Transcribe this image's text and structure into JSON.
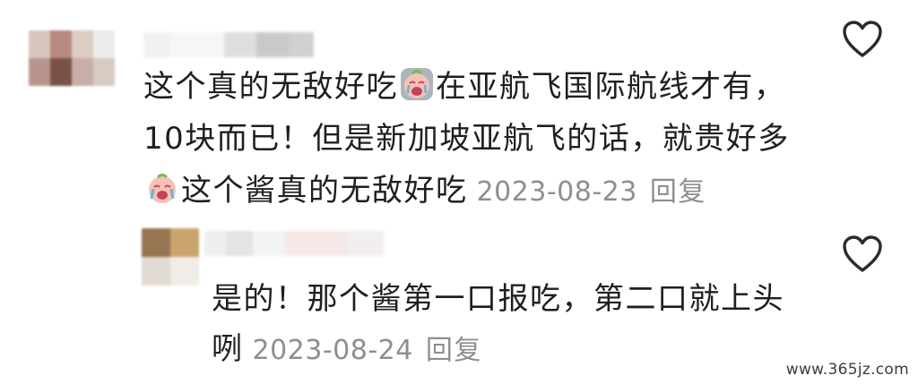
{
  "comment": {
    "text_line1_a": "这个真的无敌好吃",
    "text_line1_b": "在亚航飞国际航线才有，",
    "text_line2": "10块而已！但是新加坡亚航飞的话，就贵好多",
    "text_line3": "这个酱真的无敌好吃",
    "date": "2023-08-23",
    "reply_label": "回复",
    "emoji_1": "crying-face-emoji",
    "emoji_2": "crying-face-emoji",
    "avatar_colors": [
      "#d8c6bf",
      "#b98880",
      "#dbcdc4",
      "#ececec",
      "#b8958c",
      "#7a524a",
      "#c8aea6",
      "#d7cbc3"
    ]
  },
  "reply": {
    "text_line1": "是的！那个酱第一口报吃，第二口就上头",
    "text_line2": "咧",
    "date": "2023-08-24",
    "reply_label": "回复",
    "avatar_colors": [
      "#957552",
      "#c9a46e",
      "#e2dbd2",
      "#f0ece6"
    ]
  },
  "icons": {
    "like": "heart-outline-icon"
  },
  "colors": {
    "text": "#1f1f1f",
    "meta": "#8e8e8e",
    "icon": "#2b2b2b"
  },
  "watermark": "www.365jz.com"
}
